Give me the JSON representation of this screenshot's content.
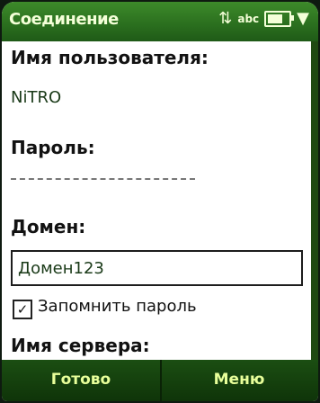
{
  "title": "Соединение",
  "status": {
    "input_mode": "abc",
    "battery_percent": 80
  },
  "form": {
    "username_label": "Имя пользователя:",
    "username_value": "NiTRO",
    "password_label": "Пароль:",
    "domain_label": "Домен:",
    "domain_value": "Домен123",
    "remember_label": "Запомнить пароль",
    "remember_checked": true,
    "server_label": "Имя сервера:"
  },
  "softkeys": {
    "left": "Готово",
    "right": "Меню"
  }
}
